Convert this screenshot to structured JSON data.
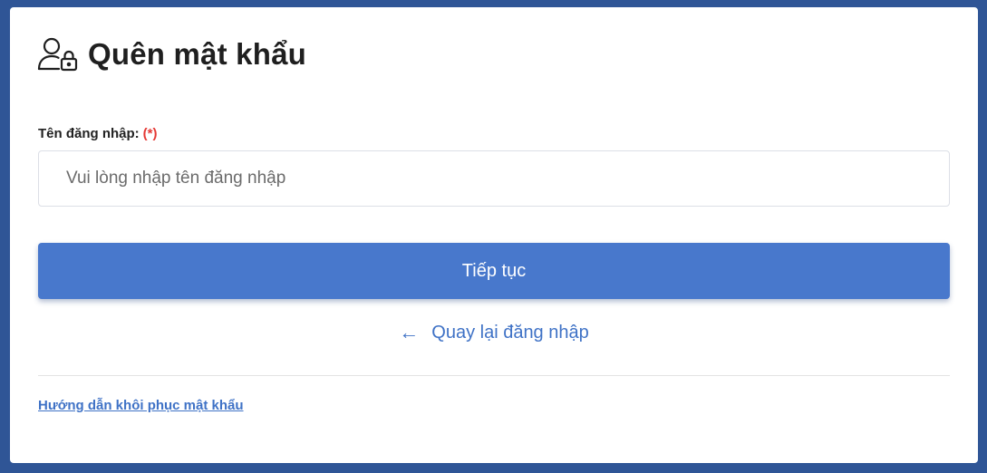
{
  "page": {
    "title": "Quên mật khẩu",
    "title_icon": "user-lock-icon"
  },
  "form": {
    "username_label": "Tên đăng nhập:",
    "required_marker": "(*)",
    "username_placeholder": "Vui lòng nhập tên đăng nhập",
    "username_value": "",
    "submit_label": "Tiếp tục"
  },
  "links": {
    "back_icon": "arrow-left-icon",
    "back_label": "Quay lại đăng nhập",
    "guide_label": "Hướng dẫn khôi phục mật khẩu"
  },
  "colors": {
    "background": "#2f5596",
    "primary": "#4878cc",
    "link": "#3f72c6",
    "required": "#e53935"
  }
}
